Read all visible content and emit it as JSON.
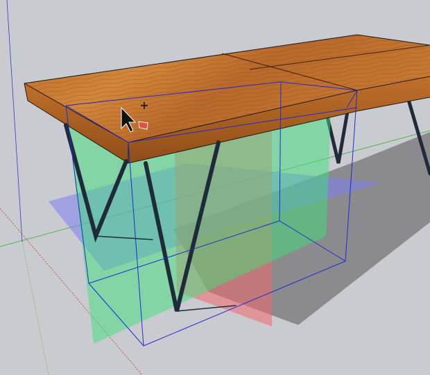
{
  "app": {
    "name": "",
    "view": "3D modeling viewport"
  },
  "scene": {
    "background_color": "#c9cbd0",
    "ground_shadow_color": "#8b8b8e",
    "tabletop_wood_light": "#c97a2c",
    "tabletop_wood_dark": "#8a4a16",
    "leg_color": "#1f2b3a",
    "selection_box_color": "#1c2bd6",
    "section_plane_green": "#3fe07a",
    "section_plane_red": "#f06a6a",
    "section_plane_blue": "#7b7ff0",
    "axis_green": "#27b627",
    "axis_red": "#c0392b",
    "axis_blue": "#2c3fd0"
  },
  "tools": {
    "active_tool": "select-cursor-icon",
    "cursor_badge": "plus-icon",
    "cursor_indicator": "red-face-indicator-icon"
  }
}
